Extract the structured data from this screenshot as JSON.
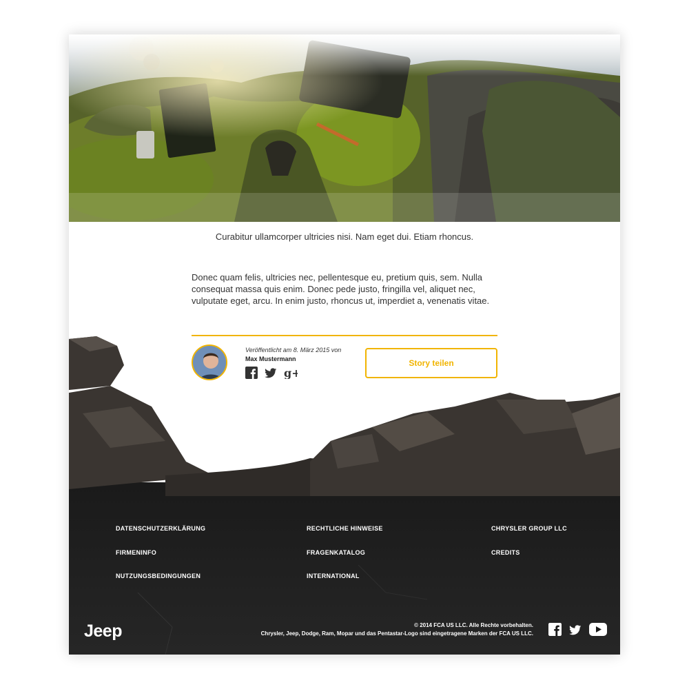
{
  "hero": {
    "image": "jeep-merchandise-on-mossy-rocks"
  },
  "content": {
    "caption": "Curabitur ullamcorper ultricies nisi. Nam eget dui. Etiam rhoncus.",
    "body": "Donec quam felis, ultricies nec, pellentesque eu, pretium quis, sem. Nulla consequat massa quis enim. Donec pede justo, fringilla vel, aliquet nec, vulputate eget, arcu. In enim justo, rhoncus ut, imperdiet a, venenatis vitae."
  },
  "author": {
    "published": "Veröffentlicht am 8. März 2015 von",
    "name": "Max Mustermann",
    "share_icons": [
      "facebook-icon",
      "twitter-icon",
      "google-plus-icon"
    ]
  },
  "share_button": {
    "label": "Story teilen"
  },
  "footer": {
    "links": [
      [
        "DATENSCHUTZERKLÄRUNG",
        "FIRMENINFO",
        "NUTZUNGSBEDINGUNGEN"
      ],
      [
        "RECHTLICHE HINWEISE",
        "FRAGENKATALOG",
        "INTERNATIONAL"
      ],
      [
        "CHRYSLER GROUP LLC",
        "CREDITS"
      ]
    ],
    "logo": "Jeep",
    "copyright": "© 2014 FCA US LLC. Alle Rechte vorbehalten.",
    "trademark": "Chrysler, Jeep, Dodge, Ram, Mopar und das Pentastar-Logo sind eingetragene Marken der FCA US LLC.",
    "social_icons": [
      "facebook-icon",
      "twitter-icon",
      "youtube-icon"
    ]
  },
  "colors": {
    "accent": "#f1b400",
    "footer_bg": "#151515",
    "text": "#333333"
  }
}
